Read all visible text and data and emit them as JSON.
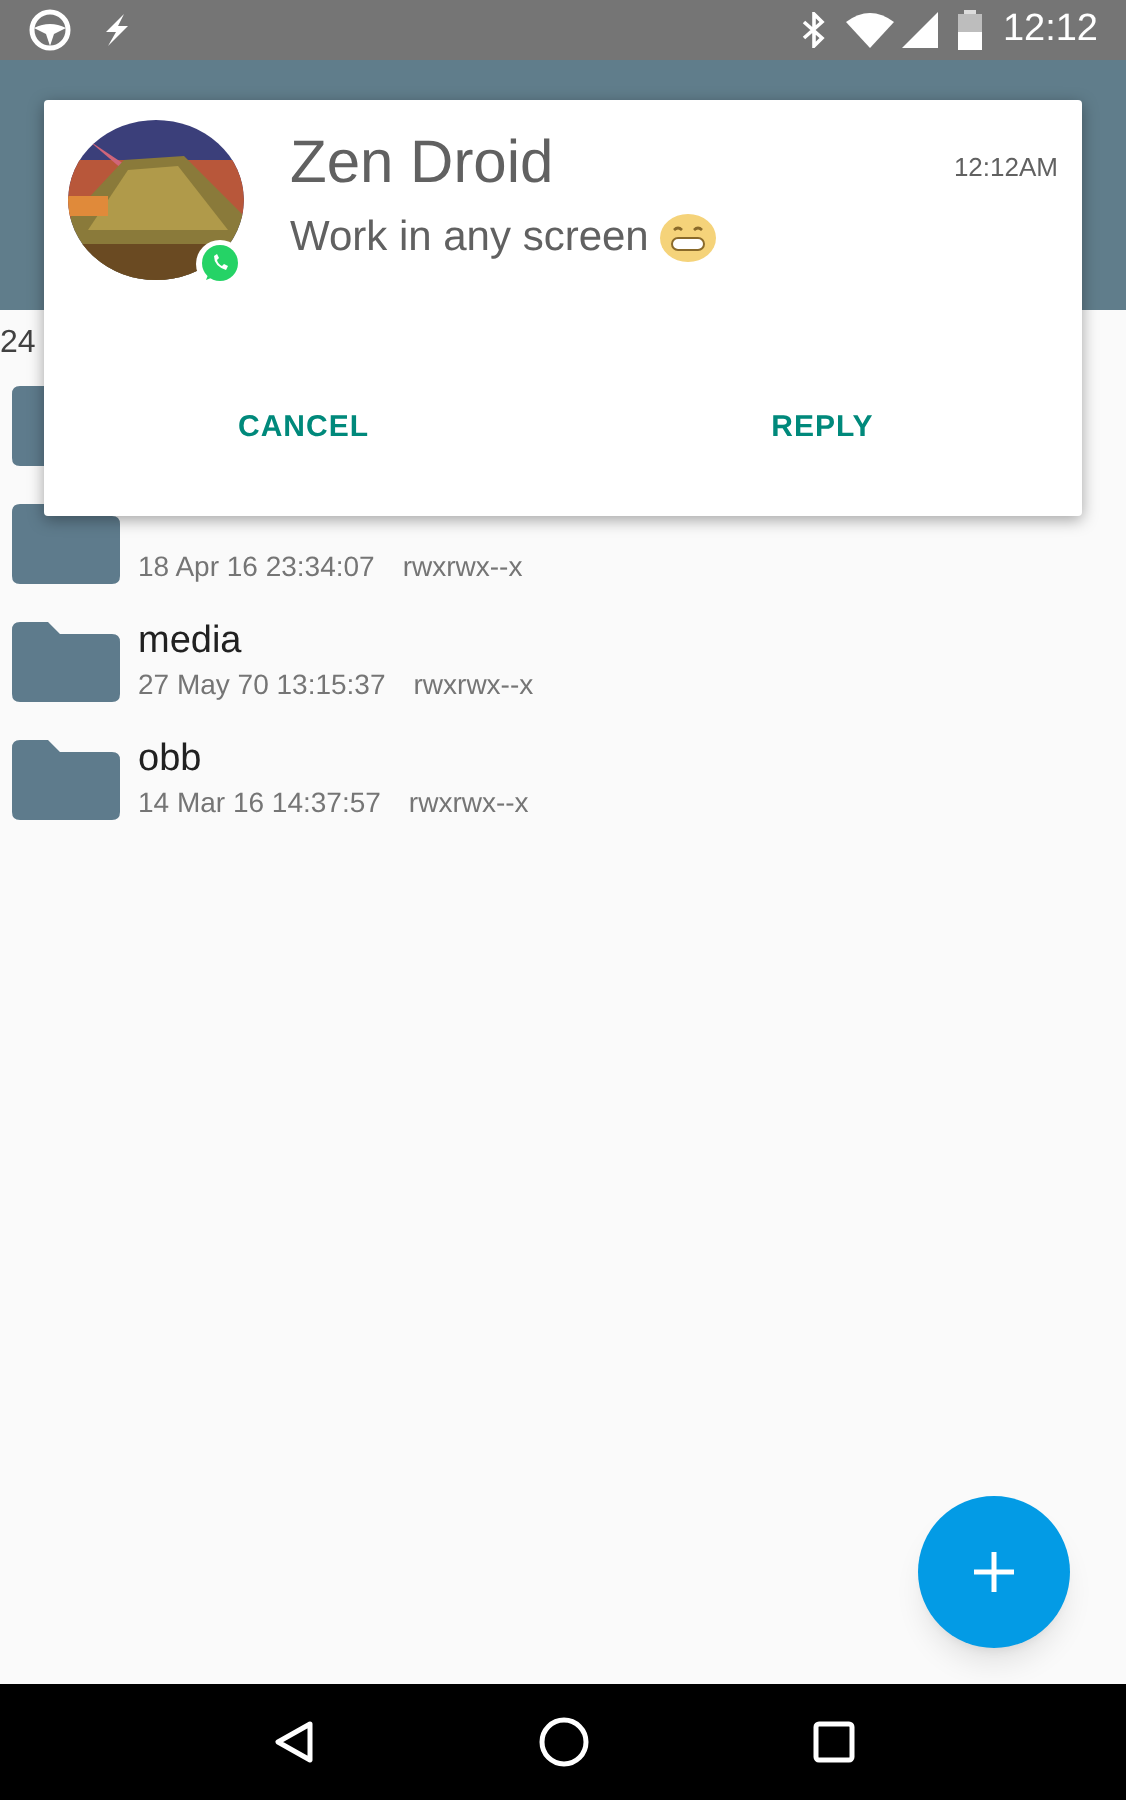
{
  "status_bar": {
    "time": "12:12"
  },
  "notification": {
    "title": "Zen Droid",
    "message": "Work in any screen",
    "time": "12:12AM",
    "actions": [
      {
        "label": "CANCEL"
      },
      {
        "label": "REPLY"
      }
    ]
  },
  "list_header": "24",
  "files": [
    {
      "kind": "folder"
    },
    {
      "kind": "folder",
      "modified": "18 Apr 16 23:34:07",
      "permissions": "rwxrwx--x"
    },
    {
      "kind": "folder",
      "name": "media",
      "modified": "27 May 70 13:15:37",
      "permissions": "rwxrwx--x"
    },
    {
      "kind": "folder",
      "name": "obb",
      "modified": "14 Mar 16 14:37:57",
      "permissions": "rwxrwx--x"
    }
  ]
}
